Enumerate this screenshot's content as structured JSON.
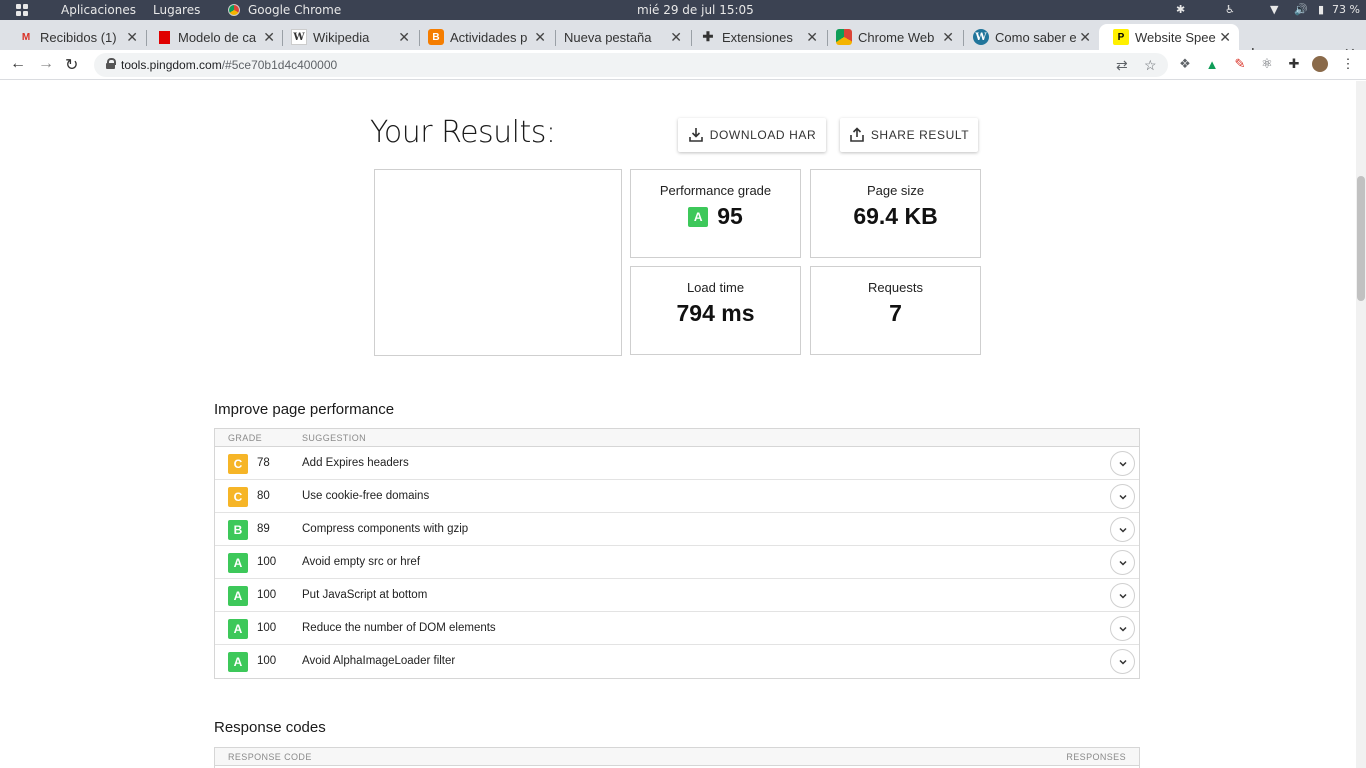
{
  "os": {
    "applications": "Aplicaciones",
    "places": "Lugares",
    "app_name": "Google Chrome",
    "datetime": "mié 29 de jul  15:05",
    "battery": "73 %"
  },
  "tabs": [
    {
      "label": "Recibidos (1)",
      "favicon": "gmail-icon",
      "color": "#d93025"
    },
    {
      "label": "Modelo de ca",
      "favicon": "red-square-icon",
      "color": "#e00000"
    },
    {
      "label": "Wikipedia",
      "favicon": "wikipedia-icon",
      "color": "#333333"
    },
    {
      "label": "Actividades p",
      "favicon": "blogger-icon",
      "color": "#f57d00"
    },
    {
      "label": "Nueva pestaña",
      "favicon": "",
      "color": ""
    },
    {
      "label": "Extensiones",
      "favicon": "puzzle-icon",
      "color": "#333333"
    },
    {
      "label": "Chrome Web",
      "favicon": "webstore-icon",
      "color": "#4285f4"
    },
    {
      "label": "Como saber e",
      "favicon": "wordpress-icon",
      "color": "#21759b"
    },
    {
      "label": "Website Spee",
      "favicon": "pingdom-icon",
      "color": "#fff000"
    }
  ],
  "address": {
    "host": "tools.pingdom.com",
    "path": "/#5ce70b1d4c400000"
  },
  "results": {
    "title": "Your Results:",
    "download_label": "DOWNLOAD HAR",
    "share_label": "SHARE RESULT",
    "metrics": {
      "grade_label": "Performance grade",
      "grade_letter": "A",
      "grade_value": "95",
      "size_label": "Page size",
      "size_value": "69.4 KB",
      "load_label": "Load time",
      "load_value": "794 ms",
      "requests_label": "Requests",
      "requests_value": "7"
    }
  },
  "improve": {
    "title": "Improve page performance",
    "col_grade": "GRADE",
    "col_suggestion": "SUGGESTION",
    "rows": [
      {
        "grade": "C",
        "score": "78",
        "suggestion": "Add Expires headers"
      },
      {
        "grade": "C",
        "score": "80",
        "suggestion": "Use cookie-free domains"
      },
      {
        "grade": "B",
        "score": "89",
        "suggestion": "Compress components with gzip"
      },
      {
        "grade": "A",
        "score": "100",
        "suggestion": "Avoid empty src or href"
      },
      {
        "grade": "A",
        "score": "100",
        "suggestion": "Put JavaScript at bottom"
      },
      {
        "grade": "A",
        "score": "100",
        "suggestion": "Reduce the number of DOM elements"
      },
      {
        "grade": "A",
        "score": "100",
        "suggestion": "Avoid AlphaImageLoader filter"
      }
    ]
  },
  "response": {
    "title": "Response codes",
    "col_code": "RESPONSE CODE",
    "col_responses": "RESPONSES"
  },
  "colors": {
    "grade_a": "#3dc85a",
    "grade_b": "#3dc85a",
    "grade_c": "#f6b527"
  }
}
